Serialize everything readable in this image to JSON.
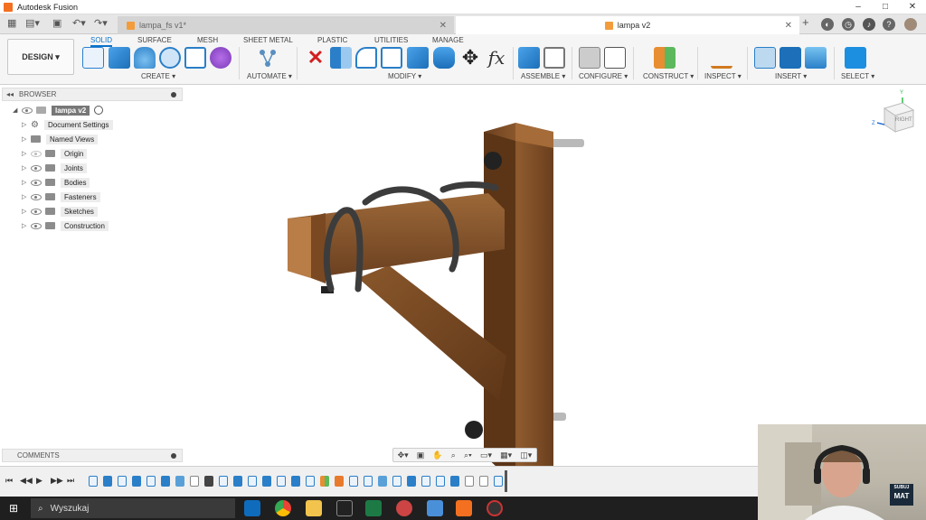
{
  "window": {
    "title": "Autodesk Fusion",
    "controls": [
      "–",
      "□",
      "✕"
    ]
  },
  "tabs": [
    {
      "label": "lampa_fs v1*",
      "active": false
    },
    {
      "label": "lampa v2",
      "active": true
    }
  ],
  "ribbon": {
    "workspace": "DESIGN",
    "workspace_caret": "▾",
    "tabs": [
      "SOLID",
      "SURFACE",
      "MESH",
      "SHEET METAL",
      "PLASTIC",
      "UTILITIES",
      "MANAGE"
    ],
    "active_tab": "SOLID",
    "groups": [
      "CREATE ▾",
      "AUTOMATE ▾",
      "MODIFY ▾",
      "ASSEMBLE ▾",
      "CONFIGURE ▾",
      "CONSTRUCT ▾",
      "INSPECT ▾",
      "INSERT ▾",
      "SELECT ▾"
    ]
  },
  "browser": {
    "title": "BROWSER",
    "root": "lampa v2",
    "items": [
      "Document Settings",
      "Named Views",
      "Origin",
      "Joints",
      "Bodies",
      "Fasteners",
      "Sketches",
      "Construction"
    ]
  },
  "comments": {
    "title": "COMMENTS"
  },
  "viewcube": {
    "face_label": "RIGHT",
    "axis_z": "Z",
    "axis_y": "Y"
  },
  "taskbar": {
    "search_placeholder": "Wyszukaj"
  },
  "webcam": {
    "badge_line1": "SUBUJ",
    "badge_line2": "MAT"
  },
  "colors": {
    "accent": "#0a72c9",
    "fusion_orange": "#f37021",
    "wood": "#8b5a2b",
    "taskbar": "#1f1f1f"
  }
}
